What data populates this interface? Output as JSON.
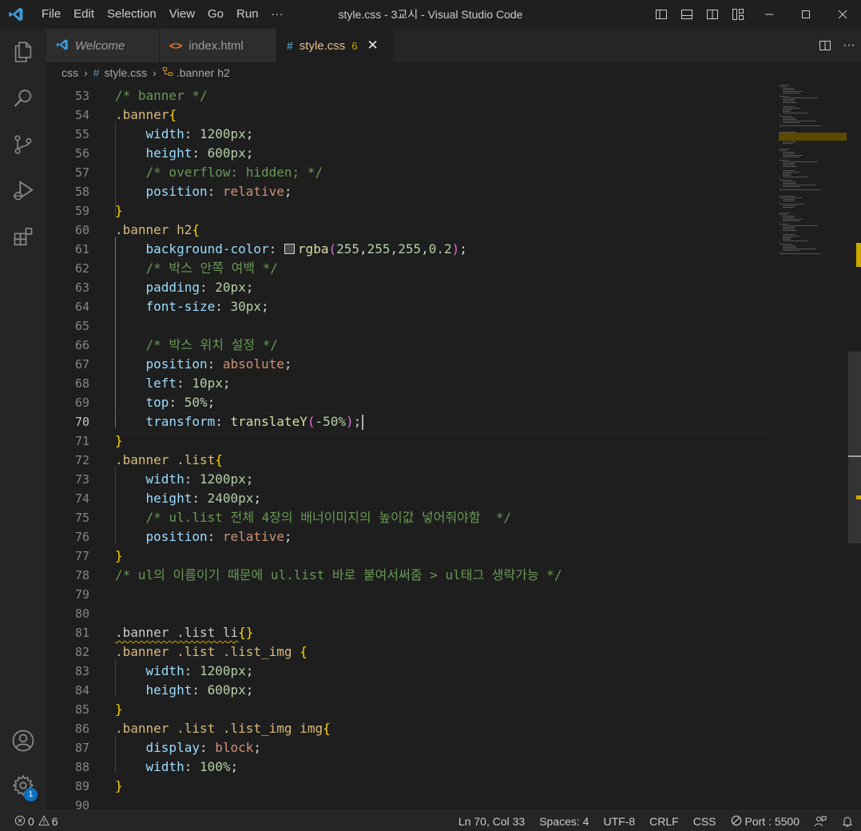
{
  "window": {
    "title": "style.css - 3교시 - Visual Studio Code",
    "menu": [
      "File",
      "Edit",
      "Selection",
      "View",
      "Go",
      "Run",
      "···"
    ]
  },
  "tabs": [
    {
      "label": "Welcome",
      "icon": "vscode-logo-icon"
    },
    {
      "label": "index.html",
      "icon": "html-code-icon"
    },
    {
      "label": "style.css",
      "icon": "css-hash-icon",
      "problems": "6",
      "active": true
    }
  ],
  "breadcrumb": {
    "folder": "css",
    "file": "style.css",
    "symbol": ".banner h2"
  },
  "editor": {
    "lines": [
      {
        "n": "53",
        "tokens": [
          [
            "cm",
            "/* banner */"
          ]
        ]
      },
      {
        "n": "54",
        "tokens": [
          [
            "sel",
            ".banner"
          ],
          [
            "br1",
            "{"
          ]
        ]
      },
      {
        "n": "55",
        "tokens": [
          [
            "pu",
            "    "
          ],
          [
            "pr",
            "width"
          ],
          [
            "pu",
            ": "
          ],
          [
            "nm",
            "1200px"
          ],
          [
            "pu",
            ";"
          ]
        ]
      },
      {
        "n": "56",
        "tokens": [
          [
            "pu",
            "    "
          ],
          [
            "pr",
            "height"
          ],
          [
            "pu",
            ": "
          ],
          [
            "nm",
            "600px"
          ],
          [
            "pu",
            ";"
          ]
        ]
      },
      {
        "n": "57",
        "tokens": [
          [
            "pu",
            "    "
          ],
          [
            "cm",
            "/* overflow: hidden; */"
          ]
        ]
      },
      {
        "n": "58",
        "tokens": [
          [
            "pu",
            "    "
          ],
          [
            "pr",
            "position"
          ],
          [
            "pu",
            ": "
          ],
          [
            "kw",
            "relative"
          ],
          [
            "pu",
            ";"
          ]
        ]
      },
      {
        "n": "59",
        "tokens": [
          [
            "br1",
            "}"
          ]
        ]
      },
      {
        "n": "60",
        "tokens": [
          [
            "sel",
            ".banner h2"
          ],
          [
            "br1",
            "{"
          ]
        ]
      },
      {
        "n": "61",
        "tokens": [
          [
            "pu",
            "    "
          ],
          [
            "pr",
            "background-color"
          ],
          [
            "pu",
            ": "
          ],
          [
            "swatch",
            ""
          ],
          [
            "fn",
            "rgba"
          ],
          [
            "br2",
            "("
          ],
          [
            "nm",
            "255"
          ],
          [
            "pu",
            ","
          ],
          [
            "nm",
            "255"
          ],
          [
            "pu",
            ","
          ],
          [
            "nm",
            "255"
          ],
          [
            "pu",
            ","
          ],
          [
            "nm",
            "0.2"
          ],
          [
            "br2",
            ")"
          ],
          [
            "pu",
            ";"
          ]
        ]
      },
      {
        "n": "62",
        "tokens": [
          [
            "pu",
            "    "
          ],
          [
            "cm",
            "/* 박스 안쪽 여백 */"
          ]
        ]
      },
      {
        "n": "63",
        "tokens": [
          [
            "pu",
            "    "
          ],
          [
            "pr",
            "padding"
          ],
          [
            "pu",
            ": "
          ],
          [
            "nm",
            "20px"
          ],
          [
            "pu",
            ";"
          ]
        ]
      },
      {
        "n": "64",
        "tokens": [
          [
            "pu",
            "    "
          ],
          [
            "pr",
            "font-size"
          ],
          [
            "pu",
            ": "
          ],
          [
            "nm",
            "30px"
          ],
          [
            "pu",
            ";"
          ]
        ]
      },
      {
        "n": "65",
        "tokens": []
      },
      {
        "n": "66",
        "tokens": [
          [
            "pu",
            "    "
          ],
          [
            "cm",
            "/* 박스 위치 설정 */"
          ]
        ]
      },
      {
        "n": "67",
        "tokens": [
          [
            "pu",
            "    "
          ],
          [
            "pr",
            "position"
          ],
          [
            "pu",
            ": "
          ],
          [
            "kw",
            "absolute"
          ],
          [
            "pu",
            ";"
          ]
        ]
      },
      {
        "n": "68",
        "tokens": [
          [
            "pu",
            "    "
          ],
          [
            "pr",
            "left"
          ],
          [
            "pu",
            ": "
          ],
          [
            "nm",
            "10px"
          ],
          [
            "pu",
            ";"
          ]
        ]
      },
      {
        "n": "69",
        "tokens": [
          [
            "pu",
            "    "
          ],
          [
            "pr",
            "top"
          ],
          [
            "pu",
            ": "
          ],
          [
            "nm",
            "50%"
          ],
          [
            "pu",
            ";"
          ]
        ]
      },
      {
        "n": "70",
        "tokens": [
          [
            "pu",
            "    "
          ],
          [
            "pr",
            "transform"
          ],
          [
            "pu",
            ": "
          ],
          [
            "fn",
            "translateY"
          ],
          [
            "br2",
            "("
          ],
          [
            "nm",
            "-50%"
          ],
          [
            "br2",
            ")"
          ],
          [
            "pu",
            ";"
          ],
          [
            "cursor",
            ""
          ]
        ],
        "current": true
      },
      {
        "n": "71",
        "tokens": [
          [
            "br1",
            "}"
          ]
        ]
      },
      {
        "n": "72",
        "tokens": [
          [
            "sel",
            ".banner .list"
          ],
          [
            "br1",
            "{"
          ]
        ]
      },
      {
        "n": "73",
        "tokens": [
          [
            "pu",
            "    "
          ],
          [
            "pr",
            "width"
          ],
          [
            "pu",
            ": "
          ],
          [
            "nm",
            "1200px"
          ],
          [
            "pu",
            ";"
          ]
        ]
      },
      {
        "n": "74",
        "tokens": [
          [
            "pu",
            "    "
          ],
          [
            "pr",
            "height"
          ],
          [
            "pu",
            ": "
          ],
          [
            "nm",
            "2400px"
          ],
          [
            "pu",
            ";"
          ]
        ]
      },
      {
        "n": "75",
        "tokens": [
          [
            "pu",
            "    "
          ],
          [
            "cm",
            "/* ul.list 전체 4장의 배너이미지의 높이값 넣어줘야함  */"
          ]
        ]
      },
      {
        "n": "76",
        "tokens": [
          [
            "pu",
            "    "
          ],
          [
            "pr",
            "position"
          ],
          [
            "pu",
            ": "
          ],
          [
            "kw",
            "relative"
          ],
          [
            "pu",
            ";"
          ]
        ]
      },
      {
        "n": "77",
        "tokens": [
          [
            "br1",
            "}"
          ]
        ]
      },
      {
        "n": "78",
        "tokens": [
          [
            "cm",
            "/* ul의 이름이기 때문에 ul.list 바로 붙여서써줌 > ul태그 생략가능 */"
          ]
        ]
      },
      {
        "n": "79",
        "tokens": []
      },
      {
        "n": "80",
        "tokens": []
      },
      {
        "n": "81",
        "tokens": [
          [
            "squig",
            ".banner .list li"
          ],
          [
            "br1",
            "{}"
          ]
        ]
      },
      {
        "n": "82",
        "tokens": [
          [
            "sel",
            ".banner .list .list_img "
          ],
          [
            "br1",
            "{"
          ]
        ]
      },
      {
        "n": "83",
        "tokens": [
          [
            "pu",
            "    "
          ],
          [
            "pr",
            "width"
          ],
          [
            "pu",
            ": "
          ],
          [
            "nm",
            "1200px"
          ],
          [
            "pu",
            ";"
          ]
        ]
      },
      {
        "n": "84",
        "tokens": [
          [
            "pu",
            "    "
          ],
          [
            "pr",
            "height"
          ],
          [
            "pu",
            ": "
          ],
          [
            "nm",
            "600px"
          ],
          [
            "pu",
            ";"
          ]
        ]
      },
      {
        "n": "85",
        "tokens": [
          [
            "br1",
            "}"
          ]
        ]
      },
      {
        "n": "86",
        "tokens": [
          [
            "sel",
            ".banner .list .list_img img"
          ],
          [
            "br1",
            "{"
          ]
        ]
      },
      {
        "n": "87",
        "tokens": [
          [
            "pu",
            "    "
          ],
          [
            "pr",
            "display"
          ],
          [
            "pu",
            ": "
          ],
          [
            "kw",
            "block"
          ],
          [
            "pu",
            ";"
          ]
        ]
      },
      {
        "n": "88",
        "tokens": [
          [
            "pu",
            "    "
          ],
          [
            "pr",
            "width"
          ],
          [
            "pu",
            ": "
          ],
          [
            "nm",
            "100%"
          ],
          [
            "pu",
            ";"
          ]
        ]
      },
      {
        "n": "89",
        "tokens": [
          [
            "br1",
            "}"
          ]
        ]
      },
      {
        "n": "90",
        "tokens": []
      }
    ]
  },
  "activity": {
    "items": [
      "explorer-icon",
      "search-icon",
      "source-control-icon",
      "run-debug-icon",
      "extensions-icon"
    ],
    "account_icon": "account-icon",
    "settings_icon": "gear-icon",
    "settings_badge": "1"
  },
  "status": {
    "errors": "0",
    "warnings": "6",
    "position": "Ln 70, Col 33",
    "spaces": "Spaces: 4",
    "encoding": "UTF-8",
    "eol": "CRLF",
    "language": "CSS",
    "port": "Port : 5500"
  },
  "colors": {
    "accent": "#0e70c0",
    "warning": "#cca700",
    "tab_active_text": "#e2c08d"
  }
}
